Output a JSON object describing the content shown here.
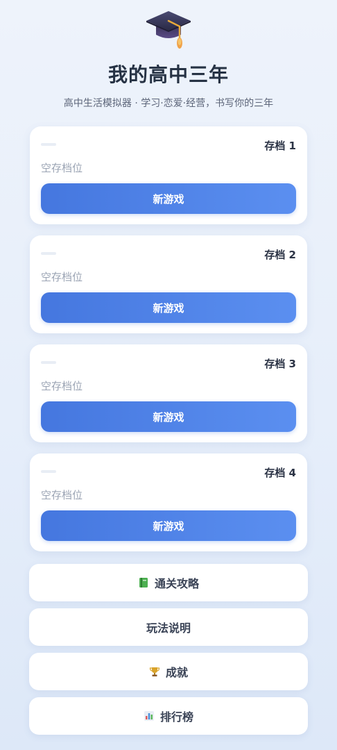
{
  "header": {
    "logo_icon": "graduation-cap-icon",
    "title": "我的高中三年",
    "subtitle": "高中生活模拟器 · 学习·恋爱·经营，书写你的三年"
  },
  "slots": [
    {
      "name": "存档 1",
      "status": "空存档位",
      "button": "新游戏"
    },
    {
      "name": "存档 2",
      "status": "空存档位",
      "button": "新游戏"
    },
    {
      "name": "存档 3",
      "status": "空存档位",
      "button": "新游戏"
    },
    {
      "name": "存档 4",
      "status": "空存档位",
      "button": "新游戏"
    }
  ],
  "menu": [
    {
      "label": "通关攻略",
      "icon": "green-book-icon"
    },
    {
      "label": "玩法说明",
      "icon": ""
    },
    {
      "label": "成就",
      "icon": "trophy-icon"
    },
    {
      "label": "排行榜",
      "icon": "bar-chart-icon"
    }
  ],
  "colors": {
    "accent": "#4577df",
    "accent_light": "#5b8ff0",
    "background": "#e6eefa",
    "title": "#263244"
  }
}
